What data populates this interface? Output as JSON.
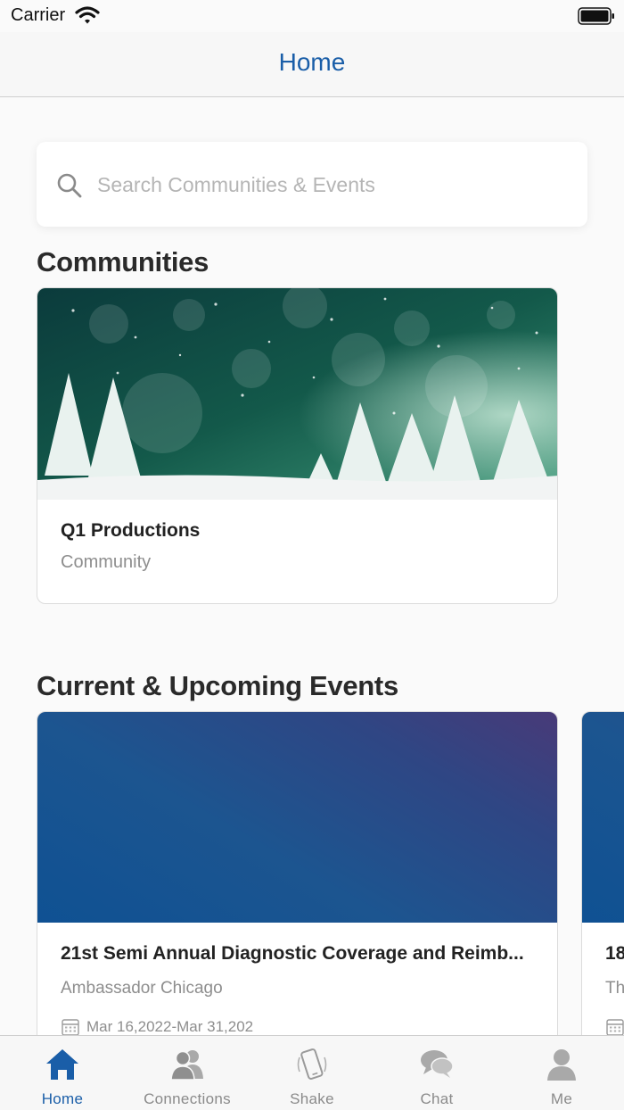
{
  "status_bar": {
    "carrier": "Carrier"
  },
  "nav": {
    "title": "Home"
  },
  "search": {
    "placeholder": "Search Communities & Events",
    "value": ""
  },
  "communities": {
    "title": "Communities",
    "items": [
      {
        "name": "Q1 Productions",
        "type": "Community"
      }
    ]
  },
  "events": {
    "title": "Current & Upcoming Events",
    "items": [
      {
        "title": "21st Semi Annual Diagnostic Coverage and Reimb...",
        "venue": "Ambassador Chicago",
        "date": "Mar 16,2022-Mar 31,202"
      },
      {
        "title": "18",
        "venue": "Th",
        "date": ""
      }
    ]
  },
  "tabs": [
    {
      "label": "Home",
      "icon": "home-icon",
      "active": true
    },
    {
      "label": "Connections",
      "icon": "connections-icon",
      "active": false
    },
    {
      "label": "Shake",
      "icon": "shake-icon",
      "active": false
    },
    {
      "label": "Chat",
      "icon": "chat-icon",
      "active": false
    },
    {
      "label": "Me",
      "icon": "profile-icon",
      "active": false
    }
  ],
  "colors": {
    "accent": "#1a5ea8",
    "inactive_tab": "#8a8a8a",
    "event_gradient_start": "#0f5193",
    "event_gradient_end": "#483a78"
  }
}
